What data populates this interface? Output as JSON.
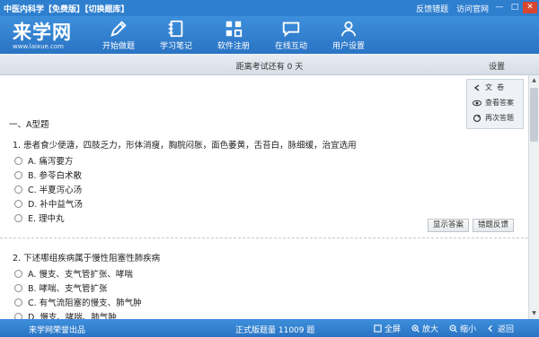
{
  "titlebar": {
    "title": "中医内科学【免费版】【切换题库】",
    "links": [
      "反馈错题",
      "访问官网"
    ],
    "window_buttons": [
      "—",
      "□",
      "✕"
    ]
  },
  "logo": {
    "main": "来学网",
    "url": "www.laixue.com"
  },
  "nav": [
    {
      "label": "开始做题",
      "icon": "pencil-icon"
    },
    {
      "label": "学习笔记",
      "icon": "notebook-icon"
    },
    {
      "label": "软件注册",
      "icon": "grid-icon"
    },
    {
      "label": "在线互动",
      "icon": "chat-icon"
    },
    {
      "label": "用户设置",
      "icon": "user-icon"
    }
  ],
  "strip": {
    "countdown": "距离考试还有 0 天",
    "settings": "设置"
  },
  "tools": [
    {
      "label": "文  卷",
      "icon": "return-icon"
    },
    {
      "label": "查看答案",
      "icon": "eye-icon"
    },
    {
      "label": "再次答题",
      "icon": "refresh-icon"
    }
  ],
  "section_title": "一、A型题",
  "questions": [
    {
      "stem": "1. 患者食少便溏，四肢乏力，形体消瘦，胸脘闷胀，面色萎黄，舌苔白，脉细缓，治宜选用",
      "options": [
        "A. 痛泻要方",
        "B. 参苓白术散",
        "C. 半夏泻心汤",
        "D. 补中益气汤",
        "E. 理中丸"
      ],
      "actions": [
        "显示答案",
        "错题反馈"
      ]
    },
    {
      "stem": "2. 下述哪组疾病属于慢性阻塞性肺疾病",
      "options": [
        "A. 慢支、支气管扩张、哮喘",
        "B. 哮喘、支气管扩张",
        "C. 有气流阻塞的慢支、肺气肿",
        "D. 慢支、哮喘、肺气肿"
      ]
    }
  ],
  "bottombar": {
    "vendor": "来学网荣誉出品",
    "count": "正式版题量 11009 题",
    "buttons": [
      {
        "label": "全屏",
        "icon": "fullscreen-icon"
      },
      {
        "label": "放大",
        "icon": "zoom-in-icon"
      },
      {
        "label": "缩小",
        "icon": "zoom-out-icon"
      },
      {
        "label": "返回",
        "icon": "back-icon"
      }
    ]
  },
  "colors": {
    "brand_blue": "#2f7fcf",
    "close_red": "#d9452f"
  }
}
